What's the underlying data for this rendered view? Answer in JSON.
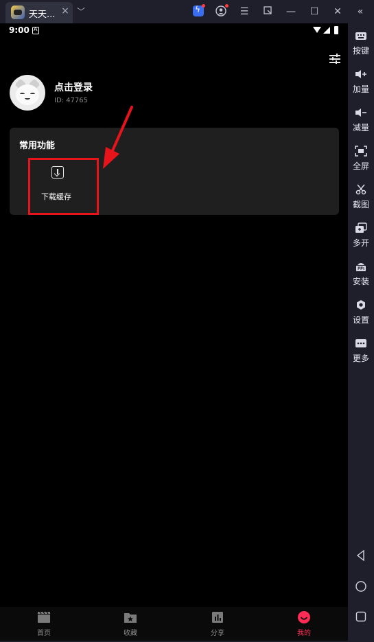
{
  "window": {
    "tab_title": "天天...",
    "tab_close": "×",
    "tab_dropdown": "﹀",
    "controls": {
      "menu": "☰",
      "minimize": "—",
      "maximize": "☐",
      "close": "✕",
      "collapse": "«"
    }
  },
  "status_bar": {
    "time": "9:00"
  },
  "profile": {
    "login_text": "点击登录",
    "user_id": "ID: 47765"
  },
  "common_functions": {
    "title": "常用功能",
    "items": [
      {
        "label": "下载缓存",
        "icon": "download-icon"
      }
    ]
  },
  "bottom_nav": {
    "items": [
      {
        "label": "首页",
        "icon": "clapperboard-icon"
      },
      {
        "label": "收藏",
        "icon": "folder-star-icon"
      },
      {
        "label": "分享",
        "icon": "chart-icon"
      },
      {
        "label": "我的",
        "icon": "smile-icon"
      }
    ],
    "active_index": 3,
    "active_color": "#ff2d55"
  },
  "sidebar": {
    "items": [
      {
        "label": "按键",
        "icon": "keyboard-icon"
      },
      {
        "label": "加量",
        "icon": "volume-up-icon"
      },
      {
        "label": "减量",
        "icon": "volume-down-icon"
      },
      {
        "label": "全屏",
        "icon": "fullscreen-icon"
      },
      {
        "label": "截图",
        "icon": "scissors-icon"
      },
      {
        "label": "多开",
        "icon": "multi-instance-icon"
      },
      {
        "label": "安装",
        "icon": "apk-icon"
      },
      {
        "label": "设置",
        "icon": "gear-icon"
      },
      {
        "label": "更多",
        "icon": "more-icon"
      }
    ],
    "system_buttons": [
      "back-icon",
      "home-icon",
      "recents-icon"
    ]
  },
  "colors": {
    "highlight": "#e8141c",
    "screen_bg": "#000000",
    "chrome_bg": "#1e1f2b"
  }
}
